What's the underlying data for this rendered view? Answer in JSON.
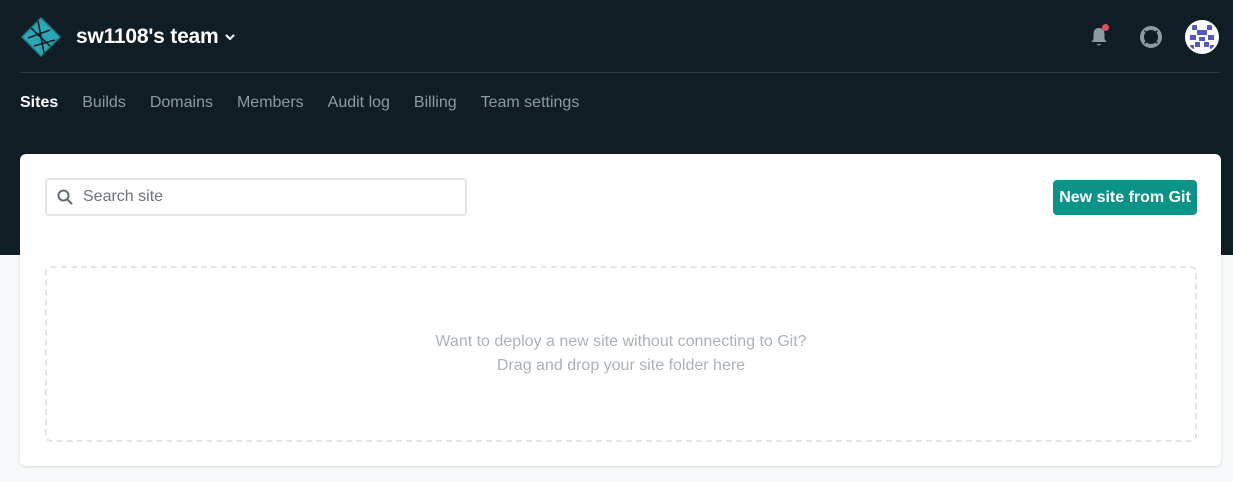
{
  "header": {
    "team_name": "sw1108's team",
    "logo_icon": "netlify-logo-icon",
    "icons": [
      "bell-icon",
      "help-lifebuoy-icon",
      "avatar-icon"
    ],
    "notification_color": "#e64e5e"
  },
  "nav": {
    "items": [
      {
        "label": "Sites",
        "active": true
      },
      {
        "label": "Builds"
      },
      {
        "label": "Domains"
      },
      {
        "label": "Members"
      },
      {
        "label": "Audit log"
      },
      {
        "label": "Billing"
      },
      {
        "label": "Team settings"
      }
    ]
  },
  "main": {
    "search": {
      "placeholder": "Search site",
      "value": ""
    },
    "new_site_button": "New site from Git",
    "dropzone": {
      "line1": "Want to deploy a new site without connecting to Git?",
      "line2": "Drag and drop your site folder here"
    }
  },
  "colors": {
    "header_bg": "#0f1e25",
    "accent": "#0a9487",
    "logo": "#2ba7b5"
  }
}
